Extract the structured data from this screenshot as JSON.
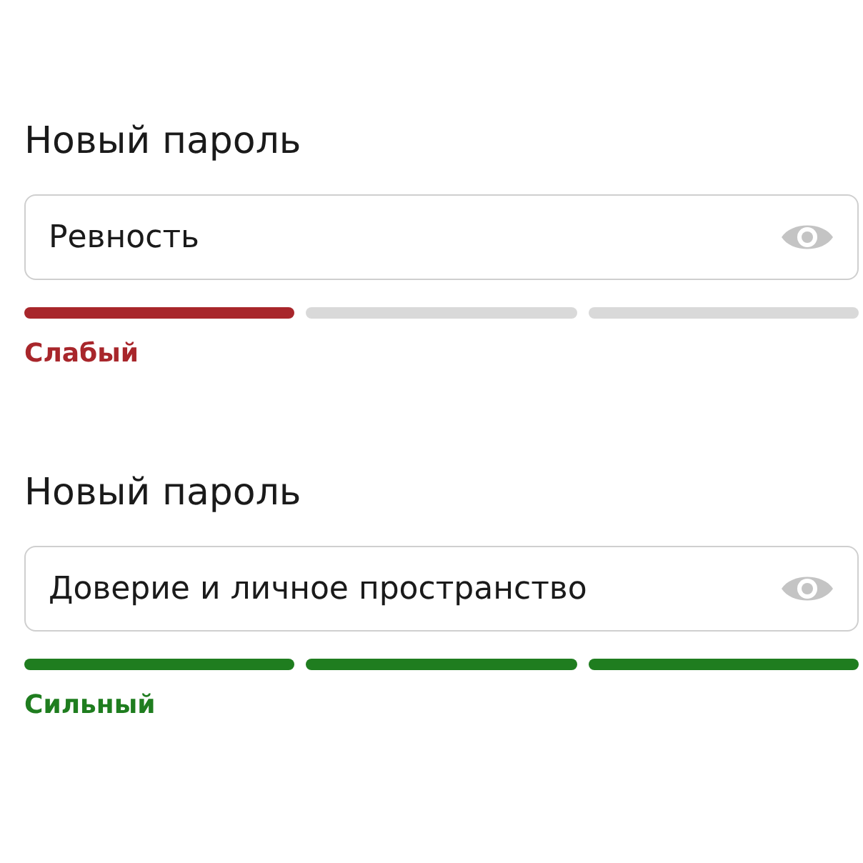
{
  "password_fields": [
    {
      "label": "Новый пароль",
      "value": "Ревность",
      "color": "#a8262b",
      "segments": [
        {
          "filled": true
        },
        {
          "filled": false
        },
        {
          "filled": false
        }
      ],
      "strength": "Слабый"
    },
    {
      "label": "Новый пароль",
      "value": "Доверие и личное пространство",
      "color": "#1f7d1f",
      "segments": [
        {
          "filled": true
        },
        {
          "filled": true
        },
        {
          "filled": true
        }
      ],
      "strength": "Сильный"
    }
  ]
}
